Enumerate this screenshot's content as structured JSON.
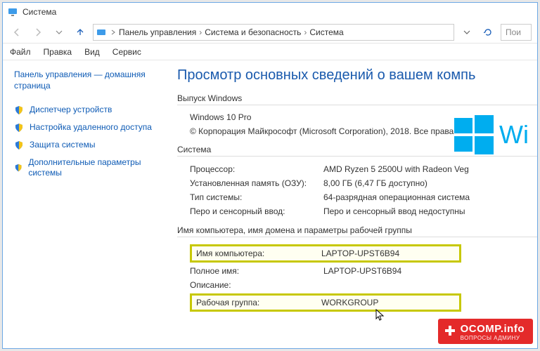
{
  "window": {
    "title": "Система"
  },
  "breadcrumb": {
    "level1": "Панель управления",
    "level2": "Система и безопасность",
    "level3": "Система"
  },
  "search": {
    "placeholder": "Пои"
  },
  "menu": {
    "file": "Файл",
    "edit": "Правка",
    "view": "Вид",
    "service": "Сервис"
  },
  "sidebar": {
    "home": "Панель управления — домашняя страница",
    "items": [
      "Диспетчер устройств",
      "Настройка удаленного доступа",
      "Защита системы",
      "Дополнительные параметры системы"
    ]
  },
  "main": {
    "heading": "Просмотр основных сведений о вашем компь",
    "edition_title": "Выпуск Windows",
    "edition_value": "Windows 10 Pro",
    "copyright": "© Корпорация Майкрософт (Microsoft Corporation), 2018. Все права",
    "system_title": "Система",
    "rows": {
      "cpu_k": "Процессор:",
      "cpu_v": "AMD Ryzen 5 2500U with Radeon Veg",
      "ram_k": "Установленная память (ОЗУ):",
      "ram_v": "8,00 ГБ (6,47 ГБ доступно)",
      "type_k": "Тип системы:",
      "type_v": "64-разрядная операционная система",
      "pen_k": "Перо и сенсорный ввод:",
      "pen_v": "Перо и сенсорный ввод недоступны"
    },
    "group_title": "Имя компьютера, имя домена и параметры рабочей группы",
    "comp": {
      "name_k": "Имя компьютера:",
      "name_v": "LAPTOP-UPST6B94",
      "full_k": "Полное имя:",
      "full_v": "LAPTOP-UPST6B94",
      "desc_k": "Описание:",
      "desc_v": "",
      "wg_k": "Рабочая группа:",
      "wg_v": "WORKGROUP"
    }
  },
  "logo_text": "Wi",
  "watermark": {
    "line1": "OCOMP.info",
    "line2": "ВОПРОСЫ АДМИНУ"
  }
}
